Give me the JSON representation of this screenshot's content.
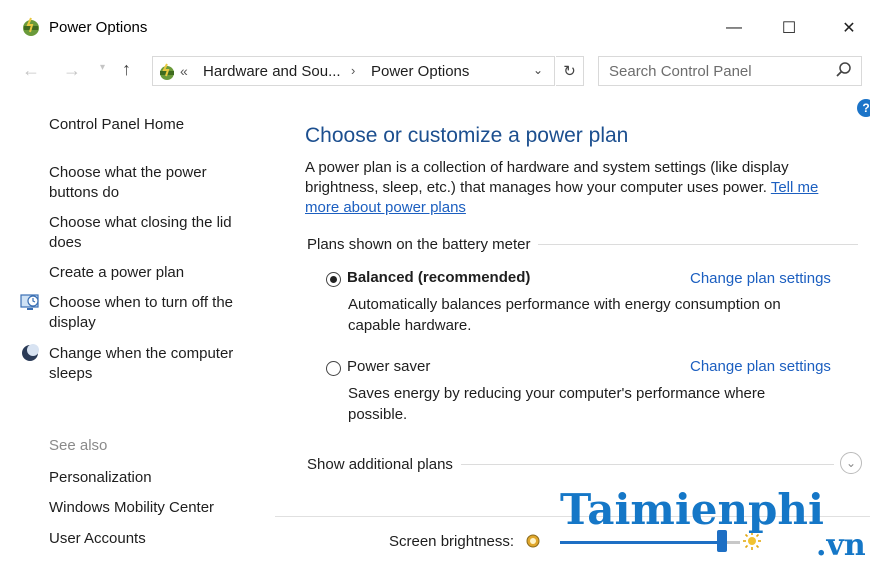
{
  "window": {
    "title": "Power Options",
    "minimize_glyph": "—",
    "maximize_glyph": "☐",
    "close_glyph": "✕"
  },
  "address_bar": {
    "chevrons": "«",
    "crumb1": "Hardware and Sou...",
    "separator": "›",
    "crumb2": "Power Options"
  },
  "search": {
    "placeholder": "Search Control Panel"
  },
  "help": {
    "label": "?"
  },
  "sidebar": {
    "home": "Control Panel Home",
    "tasks": [
      {
        "label": "Choose what the power buttons do",
        "icon": ""
      },
      {
        "label": "Choose what closing the lid does",
        "icon": ""
      },
      {
        "label": "Create a power plan",
        "icon": ""
      },
      {
        "label": "Choose when to turn off the display",
        "icon": "display-clock-icon"
      },
      {
        "label": "Change when the computer sleeps",
        "icon": "moon-icon"
      }
    ],
    "see_also_heading": "See also",
    "see_also": [
      "Personalization",
      "Windows Mobility Center",
      "User Accounts"
    ]
  },
  "main": {
    "heading": "Choose or customize a power plan",
    "description": "A power plan is a collection of hardware and system settings (like display brightness, sleep, etc.) that manages how your computer uses power.",
    "description_link": "Tell me more about power plans",
    "plans_label": "Plans shown on the battery meter",
    "plans": [
      {
        "name": "Balanced (recommended)",
        "selected": true,
        "description": "Automatically balances performance with energy consumption on capable hardware.",
        "link": "Change plan settings"
      },
      {
        "name": "Power saver",
        "selected": false,
        "description": "Saves energy by reducing your computer's performance where possible.",
        "link": "Change plan settings"
      }
    ],
    "additional_plans_label": "Show additional plans"
  },
  "brightness": {
    "label": "Screen brightness:",
    "level_percent": 90
  },
  "watermark": {
    "text": "Taimienphi",
    "sub": ".vn"
  },
  "colors": {
    "heading": "#1c4f8f",
    "link": "#1c5fc0",
    "accent": "#1e6fc4"
  }
}
